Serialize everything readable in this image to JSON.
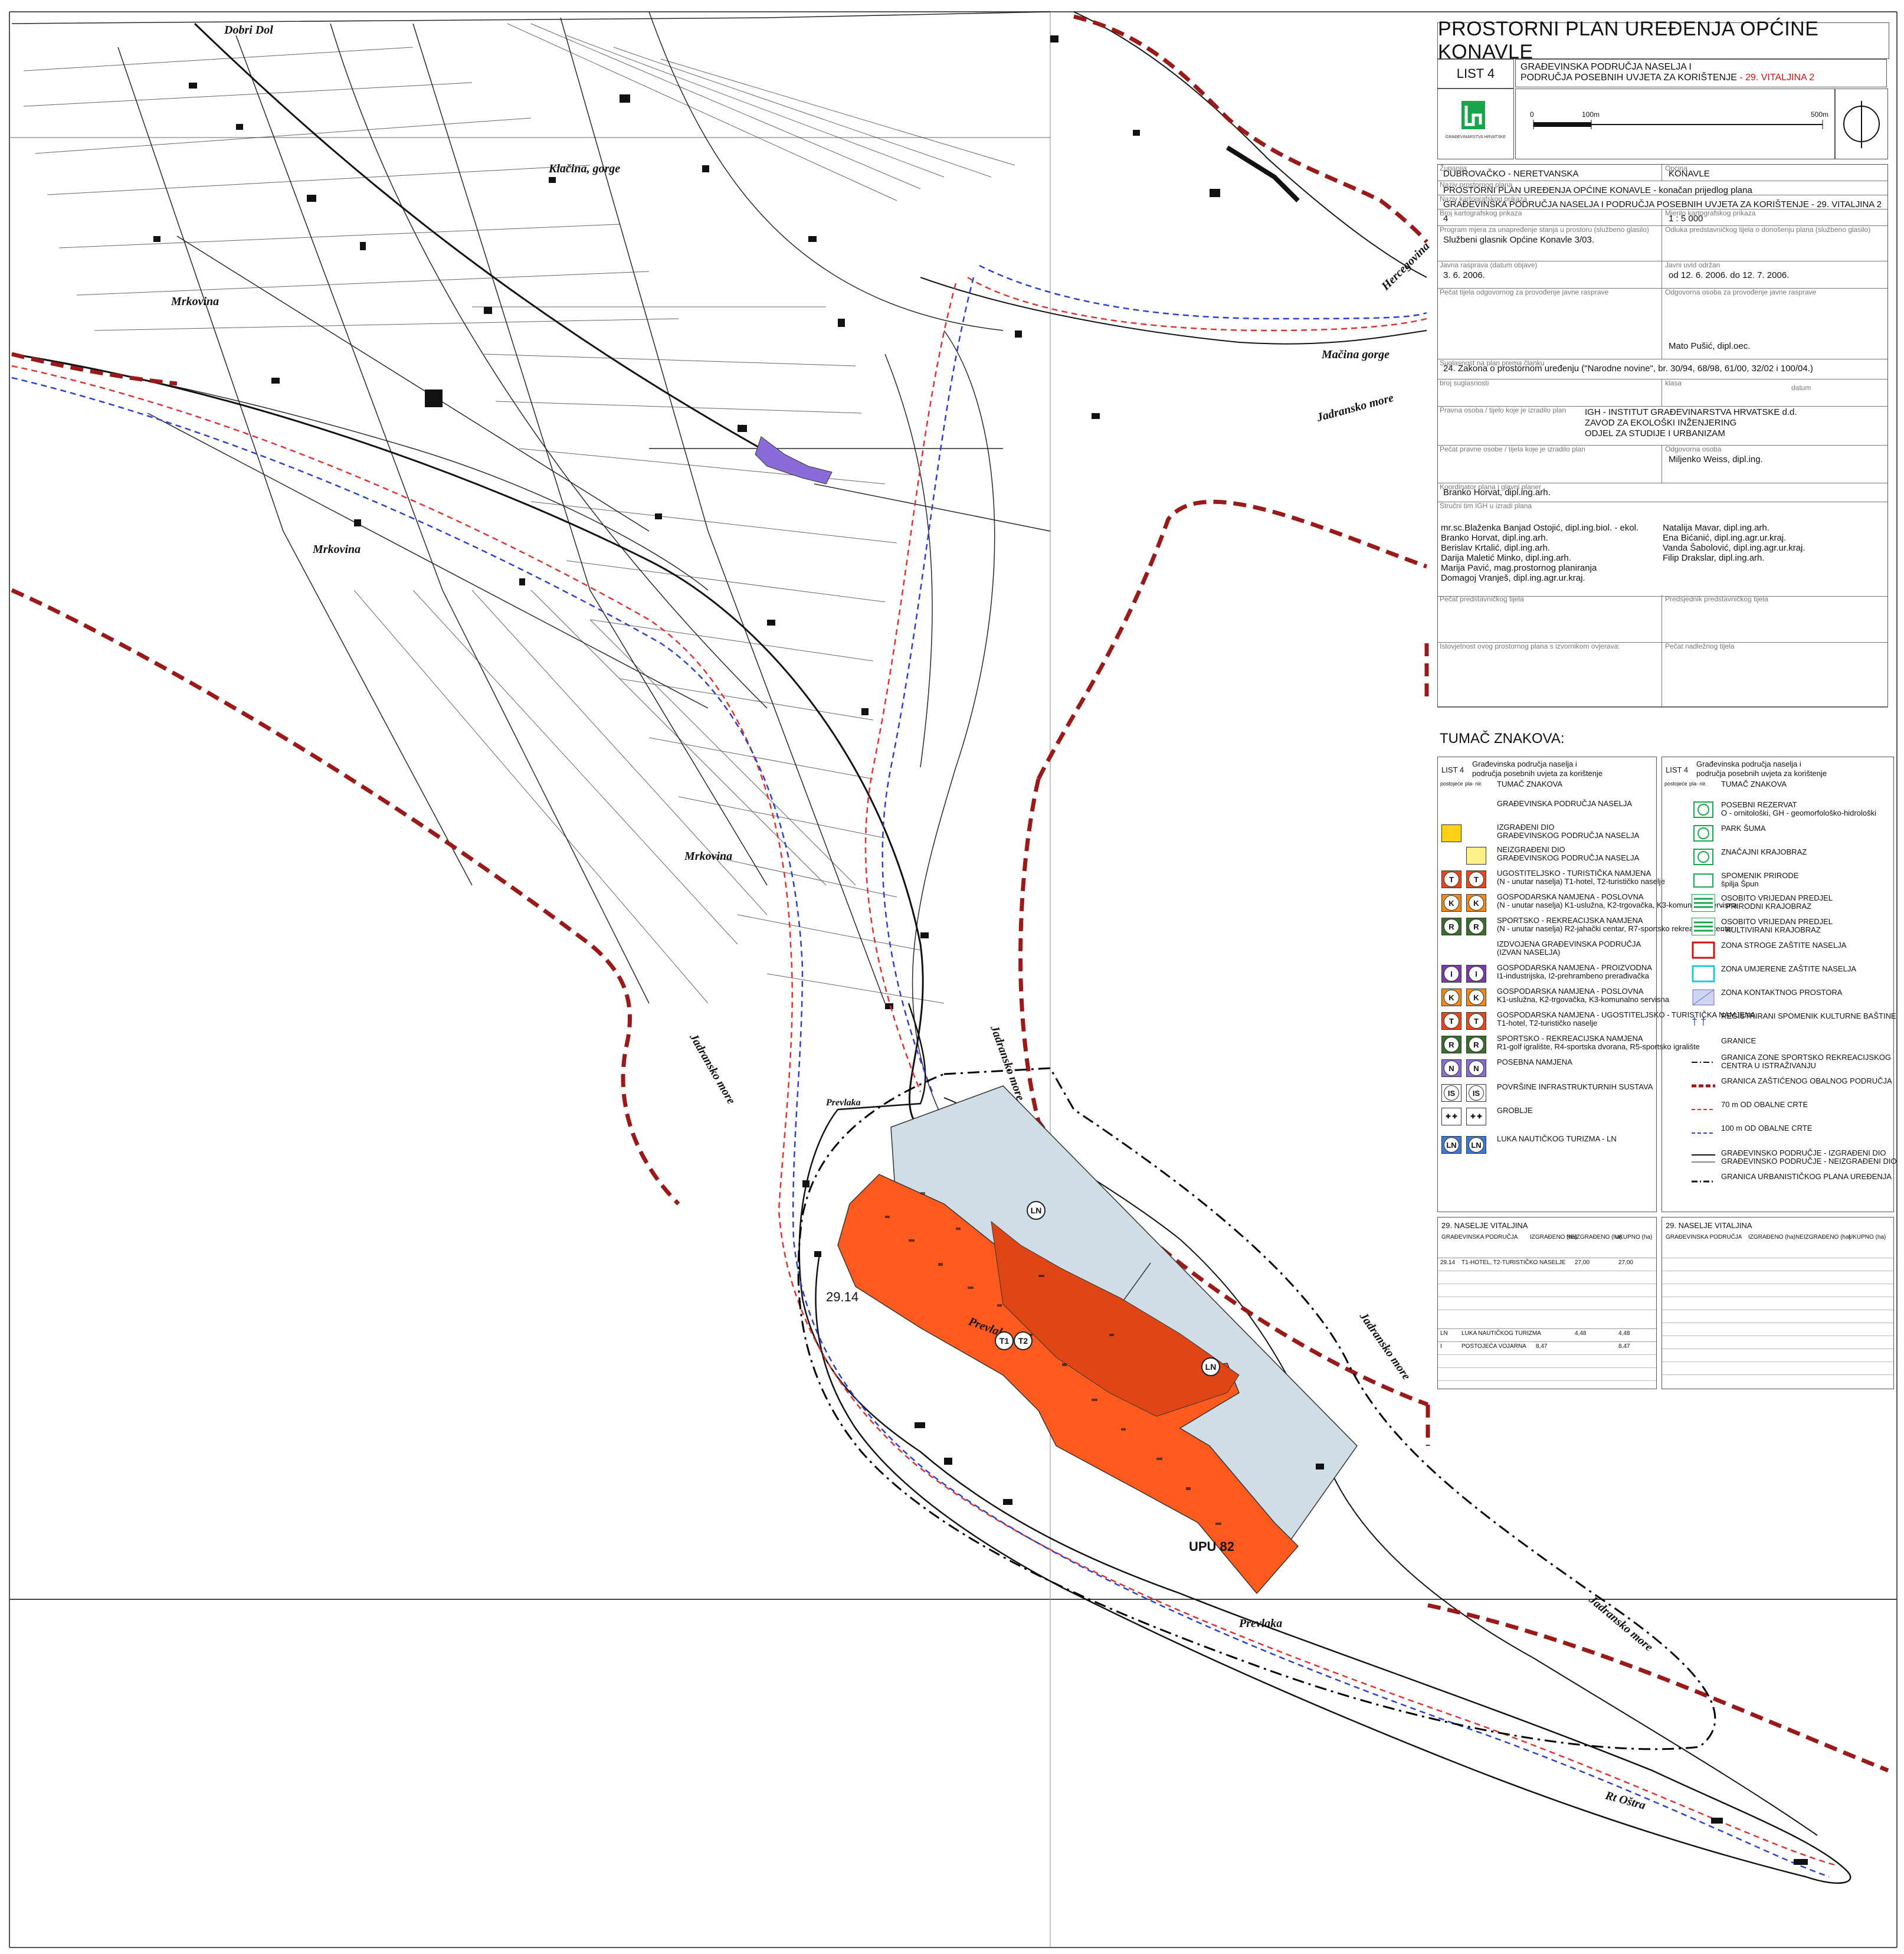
{
  "header": {
    "title": "PROSTORNI PLAN UREĐENJA OPĆINE KONAVLE",
    "list_label": "LIST 4",
    "subtitle_line1": "GRAĐEVINSKA PODRUČJA NASELJA I",
    "subtitle_line2": "PODRUČJA POSEBNIH UVJETA ZA KORIŠTENJE",
    "subtitle_red": " - 29. VITALJINA 2",
    "logo_text": "GRAĐEVINARSTVA HRVATSKE"
  },
  "scale_bar": {
    "zero": "0",
    "mid": "100m",
    "end": "500m"
  },
  "info_fields": [
    {
      "caption": "Županija",
      "value": "DUBROVAČKO - NERETVANSKA",
      "caption2": "Općina",
      "value2": "KONAVLE"
    },
    {
      "caption": "Naziv prostornog plana",
      "value": "PROSTORNI PLAN UREĐENJA OPĆINE KONAVLE - konačan prijedlog plana"
    },
    {
      "caption": "Naziv kartografskog prikaza",
      "value": "GRAĐEVINSKA PODRUČJA NASELJA I PODRUČJA POSEBNIH UVJETA ZA KORIŠTENJE - 29. VITALJINA 2"
    },
    {
      "caption": "Broj kartografskog prikaza",
      "value": "4",
      "caption2": "Mjerilo kartografskog prikaza",
      "value2": "1 : 5 000"
    },
    {
      "caption": "Program mjera za unapređenje stanja u prostoru (službeno glasilo)",
      "value": "Službeni glasnik Općine Konavle 3/03.",
      "caption2": "Odluka predstavničkog tijela o donošenju plana (službeno glasilo)",
      "value2": ""
    },
    {
      "caption": "Javna rasprava (datum objave)",
      "value": "3. 6. 2006.",
      "caption2": "Javni uvid održan",
      "value2": "od 12. 6. 2006. do 12. 7. 2006."
    },
    {
      "caption": "Pečat tijela odgovornog za provođenje javne rasprave",
      "value": "",
      "caption2": "Odgovorna osoba za provođenje javne rasprave",
      "value2": "Mato Pušić, dipl.oec."
    },
    {
      "caption": "Suglasnost na plan prema članku",
      "value": "24.  Zakona o prostornom uređenju     (\"Narodne novine\", br. 30/94, 68/98, 61/00, 32/02 i 100/04.)"
    },
    {
      "caption": "broj suglasnosti",
      "value": "",
      "caption2": "klasa",
      "value2": "",
      "caption3": "datum"
    },
    {
      "caption": "Pravna osoba / tijelo koje je izradilo plan",
      "value": "IGH - INSTITUT GRAĐEVINARSTVA HRVATSKE d.d.",
      "value_b": "ZAVOD ZA EKOLOŠKI INŽENJERING",
      "value_c": "ODJEL ZA STUDIJE I URBANIZAM"
    },
    {
      "caption": "Pečat pravne osobe / tijela koje je izradilo plan",
      "value": "",
      "caption2": "Odgovorna osoba",
      "value2": "Miljenko Weiss, dipl.ing."
    },
    {
      "caption": "Koordinator plana i glavni planer",
      "value": "Branko Horvat, dipl.ing.arh."
    },
    {
      "caption": "Stručni tim IGH u izradi plana",
      "value": ""
    },
    {
      "caption": "Pečat predstavničkog tijela",
      "value": "",
      "caption2": "Predsjednik predstavničkog tijela",
      "value2": ""
    },
    {
      "caption": "Istovjetnost ovog prostornog plana s izvornikom ovjerava:",
      "value": "",
      "caption2": "Pečat nadležnog tijela",
      "value2": ""
    }
  ],
  "team_left": [
    "mr.sc.Blaženka Banjad Ostojić, dipl.ing.biol. - ekol.",
    "Branko Horvat, dipl.ing.arh.",
    "Berislav Krtalić, dipl.ing.arh.",
    "Darija Maletić Minko, dipl.ing.arh.",
    "Marija Pavić, mag.prostornog planiranja",
    "Domagoj Vranješ, dipl.ing.agr.ur.kraj."
  ],
  "team_right": [
    "Natalija Mavar, dipl.ing.arh.",
    "Ena Bićanić, dipl.ing.agr.ur.kraj.",
    "Vanda Šabolović, dipl.ing.agr.ur.kraj.",
    "Filip Drakslar, dipl.ing.arh."
  ],
  "legend": {
    "title": "TUMAČ ZNAKOVA:",
    "list_label": "LIST 4",
    "table_title_l1": "Građevinska područja naselja i",
    "table_title_l2": "područja posebnih uvjeta za korištenje",
    "col_a": "postojeće",
    "col_b": "pla- nir.",
    "col_title": "TUMAČ ZNAKOVA",
    "left_items": [
      {
        "text": "GRAĐEVINSKA PODRUČJA NASELJA",
        "text2": ""
      },
      {
        "text": "IZGRAĐENI DIO",
        "text2": "GRAĐEVINSKOG PODRUČJA NASELJA"
      },
      {
        "text": "NEIZGRAĐENI DIO",
        "text2": "GRAĐEVINSKOG PODRUČJA NASELJA"
      },
      {
        "text": "UGOSTITELJSKO - TURISTIČKA NAMJENA",
        "text2": "(N - unutar naselja) T1-hotel, T2-turističko naselje"
      },
      {
        "text": "GOSPODARSKA NAMJENA - POSLOVNA",
        "text2": "(N - unutar naselja) K1-uslužna, K2-trgovačka, K3-komunalno servisna"
      },
      {
        "text": "SPORTSKO - REKREACIJSKA NAMJENA",
        "text2": "(N - unutar naselja) R2-jahački centar, R7-sportsko rekreacijski centar"
      },
      {
        "text": "IZDVOJENA GRAĐEVINSKA PODRUČJA",
        "text2": "(IZVAN NASELJA)"
      },
      {
        "text": "GOSPODARSKA NAMJENA - PROIZVODNA",
        "text2": "I1-industrijska, I2-prehrambeno prerađivačka"
      },
      {
        "text": "GOSPODARSKA NAMJENA - POSLOVNA",
        "text2": "K1-uslužna, K2-trgovačka, K3-komunalno servisna"
      },
      {
        "text": "GOSPODARSKA NAMJENA - UGOSTITELJSKO - TURISTIČKA NAMJENA",
        "text2": "T1-hotel, T2-turističko naselje"
      },
      {
        "text": "SPORTSKO - REKREACIJSKA NAMJENA",
        "text2": "R1-golf igralište, R4-sportska dvorana, R5-sportsko igralište"
      },
      {
        "text": "POSEBNA NAMJENA",
        "text2": ""
      },
      {
        "text": "POVRŠINE INFRASTRUKTURNIH SUSTAVA",
        "text2": ""
      },
      {
        "text": "GROBLJE",
        "text2": ""
      },
      {
        "text": "LUKA NAUTIČKOG TURIZMA - LN",
        "text2": ""
      }
    ],
    "right_items": [
      {
        "text": "POSEBNI REZERVAT",
        "text2": "O - ornitološki, GH - geomorfološko-hidrološki"
      },
      {
        "text": "PARK ŠUMA",
        "text2": ""
      },
      {
        "text": "ZNAČAJNI KRAJOBRAZ",
        "text2": ""
      },
      {
        "text": "SPOMENIK PRIRODE",
        "text2": "špilja Špun"
      },
      {
        "text": "OSOBITO VRIJEDAN PREDJEL",
        "text2": "- PRIRODNI KRAJOBRAZ"
      },
      {
        "text": "OSOBITO VRIJEDAN PREDJEL",
        "text2": "- KULTIVIRANI KRAJOBRAZ"
      },
      {
        "text": "ZONA STROGE ZAŠTITE NASELJA",
        "text2": ""
      },
      {
        "text": "ZONA UMJERENE ZAŠTITE NASELJA",
        "text2": ""
      },
      {
        "text": "ZONA KONTAKTNOG PROSTORA",
        "text2": ""
      },
      {
        "text": "REGISTRIRANI SPOMENIK KULTURNE BAŠTINE",
        "text2": ""
      },
      {
        "text": "GRANICE",
        "text2": ""
      },
      {
        "text": "GRANICA ZONE SPORTSKO REKREACIJSKOG",
        "text2": "CENTRA U ISTRAŽIVANJU"
      },
      {
        "text": "GRANICA ZAŠTIĆENOG OBALNOG PODRUČJA",
        "text2": ""
      },
      {
        "text": "70 m OD OBALNE CRTE",
        "text2": ""
      },
      {
        "text": "100 m OD OBALNE CRTE",
        "text2": ""
      },
      {
        "text": "GRAĐEVINSKO PODRUČJE - IZGRAĐENI DIO",
        "text2": "GRAĐEVINSKO PODRUČJE - NEIZGRAĐENI DIO"
      },
      {
        "text": "GRANICA URBANISTIČKOG PLANA UREĐENJA",
        "text2": ""
      }
    ]
  },
  "area_tables": {
    "left": {
      "title": "29. NASELJE VITALJINA",
      "headers": [
        "GRAĐEVINSKA PODRUČJA",
        "IZGRAĐENO (ha)",
        "NEIZGRAĐENO (ha)",
        "UKUPNO (ha)"
      ],
      "rows": [
        {
          "code": "29.14",
          "name": "T1-HOTEL, T2-TURISTIČKO NASELJE",
          "built": "",
          "unbuilt": "27,00",
          "total": "27,00"
        },
        {
          "code": "LN",
          "name": "LUKA NAUTIČKOG TURIZMA",
          "built": "",
          "unbuilt": "4,48",
          "total": "4,48"
        },
        {
          "code": "I",
          "name": "POSTOJEĆA VOJARNA",
          "built": "8,47",
          "unbuilt": "",
          "total": "8,47"
        }
      ]
    },
    "right": {
      "title": "29. NASELJE VITALJINA",
      "headers": [
        "GRAĐEVINSKA PODRUČJA",
        "IZGRAĐENO (ha)",
        "NEIZGRAĐENO (ha)",
        "UKUPNO (ha)"
      ]
    }
  },
  "map_labels": {
    "dobri_dol": "Dobri Dol",
    "klacina": "Klačina, gorge",
    "mrkovina": "Mrkovina",
    "hercegovina": "Hercegovina",
    "macina": "Mačina gorge",
    "jadransko_ne": "Jadransko more",
    "jadransko_w": "Jadransko more",
    "jadransko_mid": "Jadransko more",
    "jadransko_e": "Jadransko more",
    "jadransko_se": "Jadransko more",
    "prevlaka_n": "Prevlaka",
    "prevlaka_mid": "Prevlaka",
    "prevlaka_s": "Prevlaka",
    "rt_ostra": "Rt Oštra",
    "zone_code": "29.14",
    "upu": "UPU 82",
    "ln1": "LN",
    "ln2": "LN",
    "t1": "T1",
    "t2": "T2",
    "n": "N"
  },
  "colors": {
    "built_zone": "#ff5a1e",
    "built_zone_dark": "#e04515",
    "harbour": "#cfdde6",
    "coastal_boundary": "#9a1a1a",
    "line_70m": "#e03030",
    "line_100m": "#2a3ed0",
    "special": "#8a6bd8",
    "yellow_built": "#ffd21a",
    "yellow_unbuilt": "#fff08a"
  }
}
